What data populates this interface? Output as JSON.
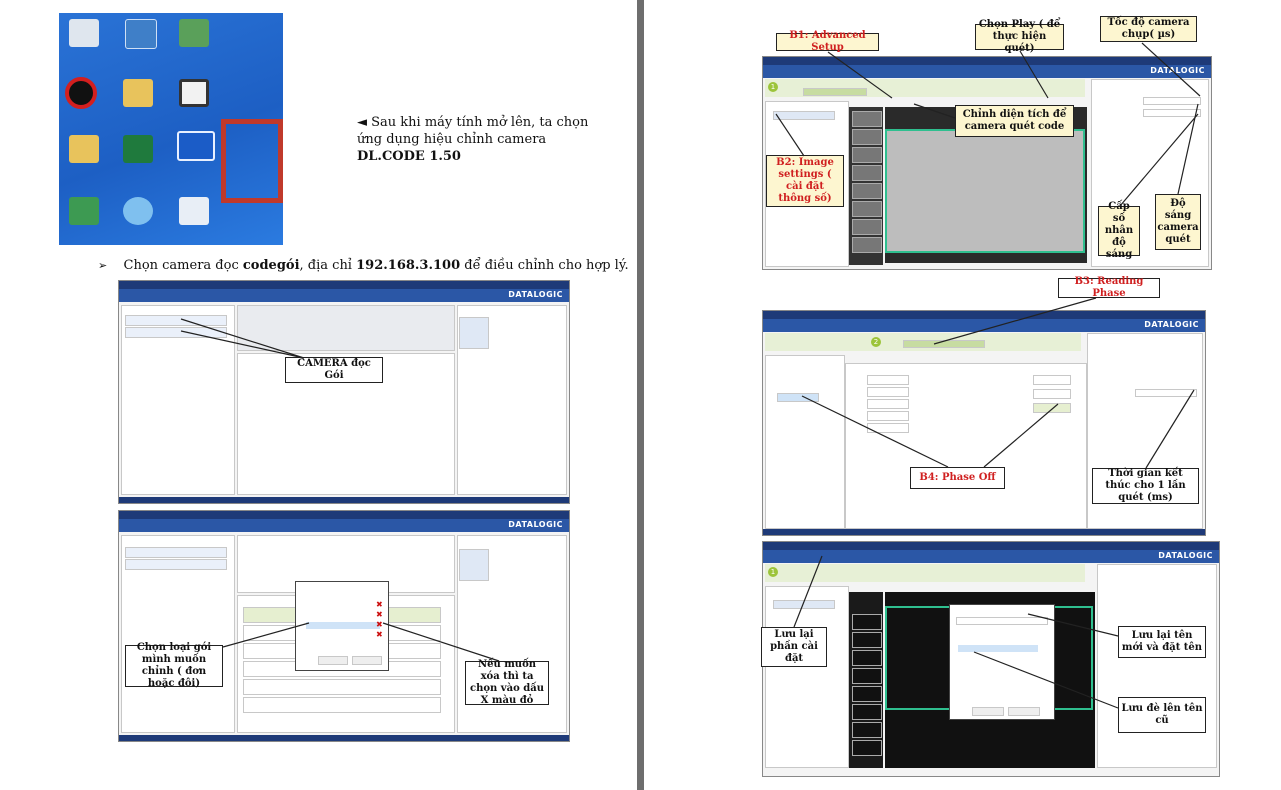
{
  "left_page": {
    "step1_caption": {
      "line1": "◄ Sau khi máy tính mở lên, ta chọn",
      "line2": "ứng dụng hiệu chỉnh camera",
      "line3": "DL.CODE 1.50"
    },
    "step2_caption": {
      "bullet": "➢",
      "prefix": "Chọn camera đọc ",
      "camera": "codegói",
      "middle": ", địa chỉ ",
      "ip": "192.168.3.100",
      "suffix": " để điều chỉnh cho hợp lý."
    },
    "screenshot1": {
      "brand": "DATALOGIC",
      "callout": "CAMERA  đọc Gói"
    },
    "screenshot2": {
      "brand": "DATALOGIC",
      "callout_left": "Chọn loại gói mình muốn chỉnh ( đơn hoặc đôi)",
      "callout_right": "Nếu muốn xóa thì ta chọn vào dấu X màu đỏ"
    }
  },
  "right_page": {
    "screenshot1": {
      "brand": "DATALOGIC",
      "callouts": {
        "b1": "B1: Advanced Setup",
        "play": "Chọn Play ( để thực hiện quét)",
        "speed": "Tốc độ camera chụp( µs)",
        "screen": "Chỉnh diện tích để camera quét code",
        "b2": "B2: Image settings ( cài đặt thông số)",
        "gain": "Cấp số nhân độ sáng",
        "bright": "Độ sáng camera quét"
      }
    },
    "screenshot2": {
      "brand": "DATALOGIC",
      "callouts": {
        "b3": "B3: Reading Phase",
        "b4": "B4: Phase Off",
        "endtime": "Thời gian kết thúc cho 1 lần quét (ms)"
      }
    },
    "screenshot3": {
      "brand": "DATALOGIC",
      "callouts": {
        "save_part": "Lưu lại phần cài đặt",
        "save_new": "Lưu lại tên mới và đặt tên",
        "overwrite": "Lưu đè lên tên cũ"
      }
    }
  },
  "colors": {
    "callout_red_text": "#d02020",
    "callout_yellow_bg": "#fdf6d0",
    "highlight_border": "#c0392b",
    "toolbar_blue": "#2b57a6",
    "divider_gray": "#6e6e6e"
  }
}
